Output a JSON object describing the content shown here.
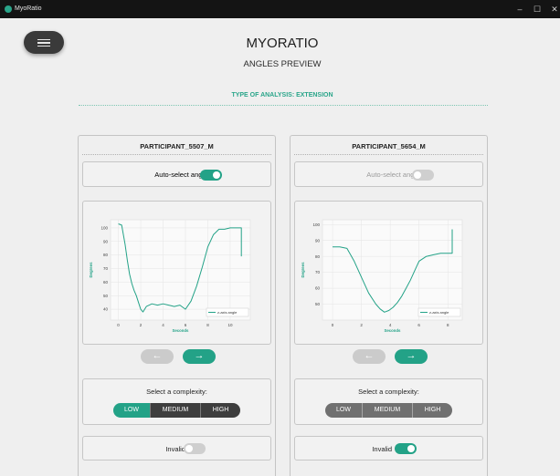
{
  "window": {
    "title": "MyoRatio",
    "minimize": "–",
    "maximize": "☐",
    "close": "✕"
  },
  "menu": {
    "icon": "hamburger-menu-icon"
  },
  "header": {
    "title": "MYORATIO",
    "subtitle": "ANGLES PREVIEW",
    "analysis_type": "TYPE OF ANALYSIS: EXTENSION"
  },
  "colors": {
    "accent": "#23a287",
    "dark_segment": "#3e3e3e",
    "disabled": "#cfcfcf",
    "titlebar": "#141414"
  },
  "panels": [
    {
      "participant": "PARTICIPANT_5507_M",
      "auto_select_label": "Auto-select angles",
      "auto_select": true,
      "prev_icon": "←",
      "next_icon": "→",
      "complexity_label": "Select a complexity:",
      "complexity_options": [
        "LOW",
        "MEDIUM",
        "HIGH"
      ],
      "complexity_selected": "LOW",
      "invalid_label": "Invalid",
      "invalid": false
    },
    {
      "participant": "PARTICIPANT_5654_M",
      "auto_select_label": "Auto-select angles",
      "auto_select": false,
      "prev_icon": "←",
      "next_icon": "→",
      "complexity_label": "Select a complexity:",
      "complexity_options": [
        "LOW",
        "MEDIUM",
        "HIGH"
      ],
      "complexity_selected": "",
      "invalid_label": "Invalid",
      "invalid": true
    }
  ],
  "chart_data": [
    {
      "type": "line",
      "xlabel": "Seconds",
      "ylabel": "Degrees",
      "xlim": [
        -0.7,
        11.8
      ],
      "ylim": [
        32,
        106
      ],
      "xticks": [
        0,
        2,
        4,
        6,
        8,
        10
      ],
      "yticks": [
        40,
        50,
        60,
        70,
        80,
        90,
        100
      ],
      "grid": true,
      "legend": "bottom-right",
      "series": [
        {
          "name": "z-axis angle",
          "color": "#23a287",
          "x": [
            0,
            0.3,
            0.6,
            0.8,
            1.0,
            1.2,
            1.4,
            1.6,
            1.8,
            2.0,
            2.2,
            2.5,
            3.0,
            3.5,
            4.0,
            4.5,
            5.0,
            5.5,
            6.0,
            6.5,
            7.0,
            7.5,
            8.0,
            8.5,
            9.0,
            9.5,
            10.0,
            10.5,
            11.0,
            11.0
          ],
          "y": [
            103,
            102,
            88,
            76,
            66,
            59,
            54,
            50,
            45,
            40,
            38,
            42,
            44,
            43,
            44,
            43,
            42,
            43,
            40,
            46,
            57,
            71,
            86,
            95,
            99,
            99,
            100,
            100,
            100,
            79
          ]
        }
      ]
    },
    {
      "type": "line",
      "xlabel": "Seconds",
      "ylabel": "Degrees",
      "xlim": [
        -0.7,
        9.0
      ],
      "ylim": [
        40,
        103
      ],
      "xticks": [
        0,
        2,
        4,
        6,
        8
      ],
      "yticks": [
        50,
        60,
        70,
        80,
        90,
        100
      ],
      "grid": true,
      "legend": "bottom-right",
      "series": [
        {
          "name": "z-axis angle",
          "color": "#23a287",
          "x": [
            0,
            0.5,
            1.0,
            1.5,
            2.0,
            2.5,
            3.0,
            3.3,
            3.6,
            3.9,
            4.2,
            4.5,
            4.8,
            5.1,
            5.4,
            5.7,
            6.0,
            6.5,
            7.0,
            7.5,
            8.0,
            8.2,
            8.3,
            8.3
          ],
          "y": [
            86,
            86,
            85,
            77,
            67,
            57,
            50,
            47,
            45,
            46,
            48,
            51,
            55,
            60,
            65,
            71,
            77,
            80,
            81,
            82,
            82,
            82,
            82,
            97
          ]
        }
      ]
    }
  ]
}
